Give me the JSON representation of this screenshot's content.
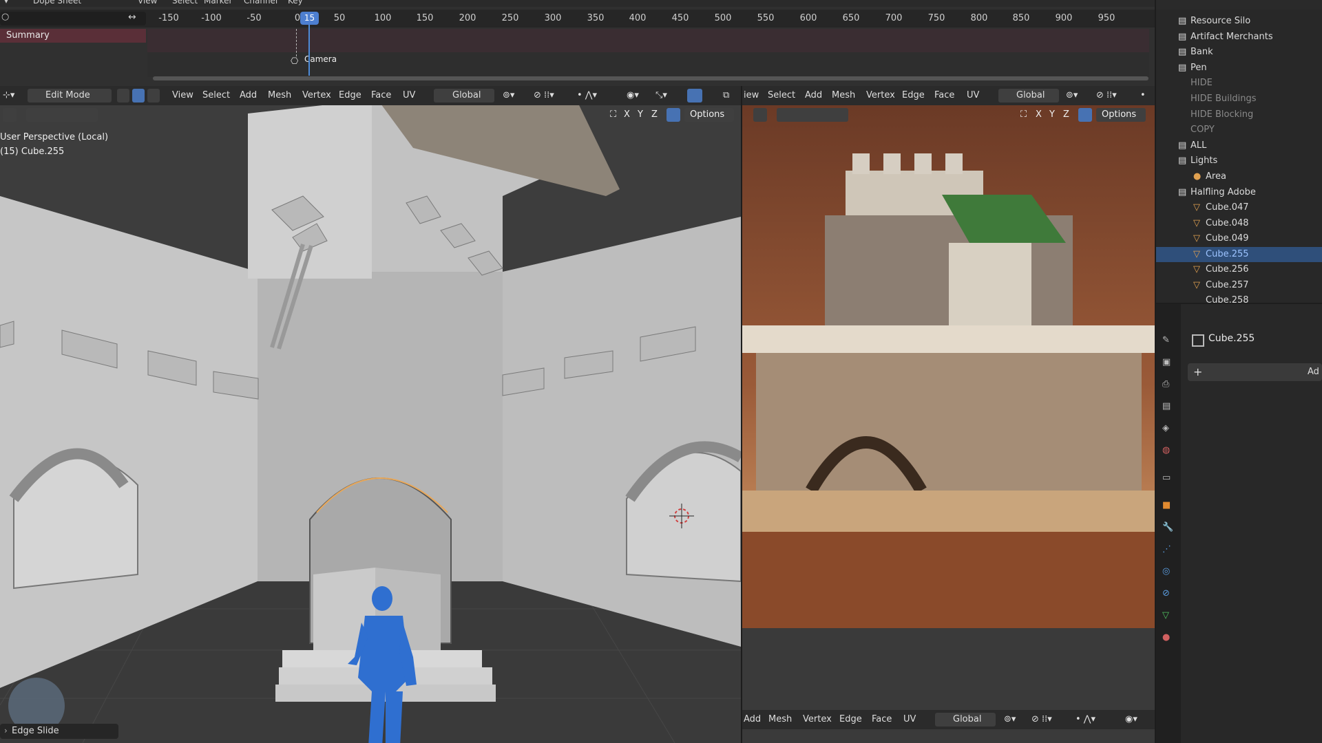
{
  "dope_sheet": {
    "editor_label": "Dope Sheet",
    "menus": [
      "View",
      "Select",
      "Marker",
      "Channel",
      "Key"
    ],
    "ruler_ticks": [
      "-150",
      "-100",
      "-50",
      "0",
      "50",
      "100",
      "150",
      "200",
      "250",
      "300",
      "350",
      "400",
      "450",
      "500",
      "550",
      "600",
      "650",
      "700",
      "750",
      "800",
      "850",
      "900",
      "950"
    ],
    "current_frame": "15",
    "summary_label": "Summary",
    "camera_label": "Camera"
  },
  "viewport_left": {
    "mode": "Edit Mode",
    "menus": [
      "View",
      "Select",
      "Add",
      "Mesh",
      "Vertex",
      "Edge",
      "Face",
      "UV"
    ],
    "transform_orientation": "Global",
    "axes": [
      "X",
      "Y",
      "Z"
    ],
    "options_label": "Options",
    "perspective_text": "User Perspective (Local)",
    "object_text": "(15) Cube.255",
    "operator_panel": "Edge Slide"
  },
  "viewport_right": {
    "menus": [
      "iew",
      "Select",
      "Add",
      "Mesh",
      "Vertex",
      "Edge",
      "Face",
      "UV"
    ],
    "transform_orientation": "Global",
    "axes": [
      "X",
      "Y",
      "Z"
    ],
    "options_label": "Options",
    "bottom_menus": [
      "Add",
      "Mesh",
      "Vertex",
      "Edge",
      "Face",
      "UV"
    ],
    "bottom_orientation": "Global"
  },
  "outliner": {
    "rows": [
      {
        "label": "Resource Silo",
        "type": "collection",
        "state": "normal"
      },
      {
        "label": "Artifact Merchants",
        "type": "collection",
        "state": "normal"
      },
      {
        "label": "Bank",
        "type": "collection",
        "state": "normal"
      },
      {
        "label": "Pen",
        "type": "collection",
        "state": "normal"
      },
      {
        "label": "HIDE",
        "type": "collection",
        "state": "dim"
      },
      {
        "label": "HIDE Buildings",
        "type": "collection",
        "state": "dim"
      },
      {
        "label": "HIDE Blocking",
        "type": "collection",
        "state": "dim"
      },
      {
        "label": "COPY",
        "type": "collection",
        "state": "dim"
      },
      {
        "label": "ALL",
        "type": "collection",
        "state": "normal"
      },
      {
        "label": "Lights",
        "type": "collection",
        "state": "normal"
      },
      {
        "label": "Area",
        "type": "light",
        "state": "normal"
      },
      {
        "label": "Halfling Adobe",
        "type": "collection",
        "state": "normal"
      },
      {
        "label": "Cube.047",
        "type": "mesh",
        "state": "normal"
      },
      {
        "label": "Cube.048",
        "type": "mesh",
        "state": "normal"
      },
      {
        "label": "Cube.049",
        "type": "mesh",
        "state": "normal"
      },
      {
        "label": "Cube.255",
        "type": "mesh",
        "state": "selected"
      },
      {
        "label": "Cube.256",
        "type": "mesh",
        "state": "normal"
      },
      {
        "label": "Cube.257",
        "type": "mesh",
        "state": "normal"
      },
      {
        "label": "Cube.258",
        "type": "mesh",
        "state": "normal"
      }
    ]
  },
  "properties": {
    "object_name": "Cube.255",
    "add_label": "Ad"
  },
  "colors": {
    "accent": "#4772b3",
    "selected_text": "#9cc3ff",
    "character": "#2f6fd0"
  }
}
